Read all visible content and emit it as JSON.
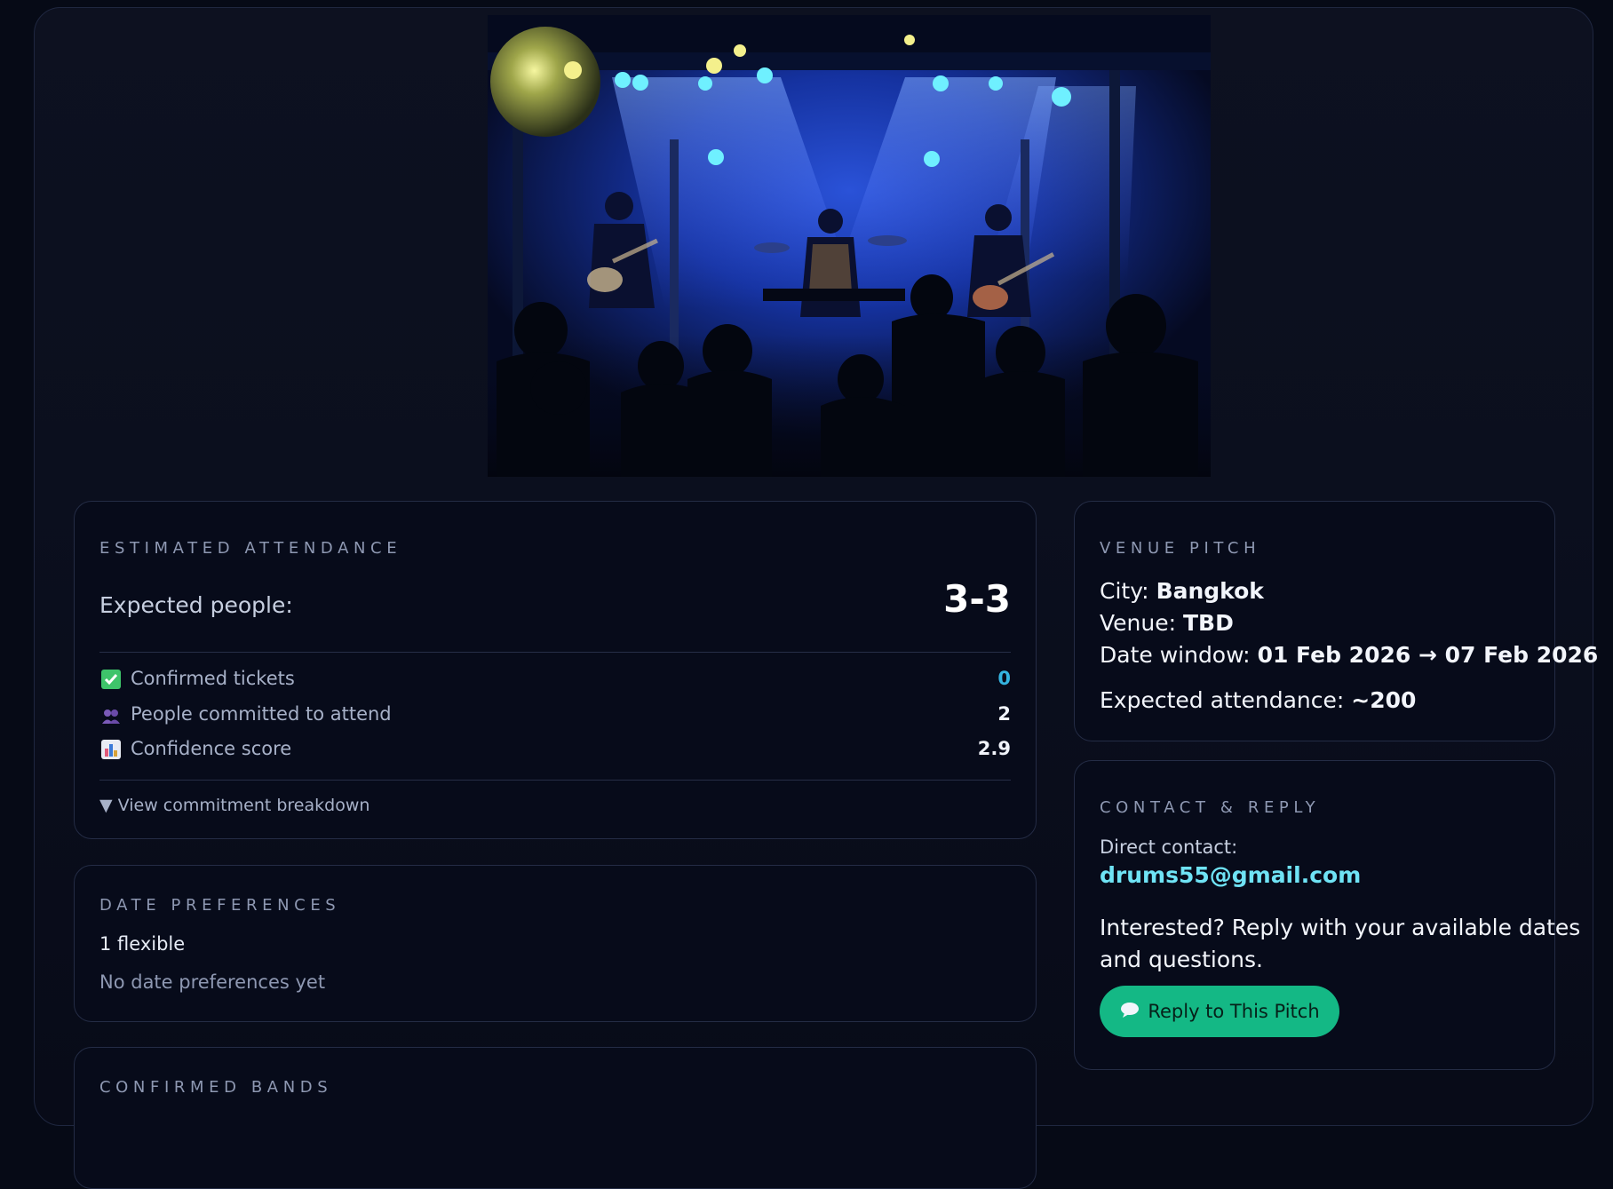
{
  "attendance": {
    "heading": "ESTIMATED ATTENDANCE",
    "expected_label": "Expected people:",
    "expected_value": "3-3",
    "rows": [
      {
        "icon": "check-box-icon",
        "label": "Confirmed tickets",
        "value": "0",
        "color": "#34b4e0"
      },
      {
        "icon": "people-icon",
        "label": "People committed to attend",
        "value": "2",
        "color": "#f0f3fa"
      },
      {
        "icon": "bar-chart-icon",
        "label": "Confidence score",
        "value": "2.9",
        "color": "#f0f3fa"
      }
    ],
    "breakdown_arrow": "▼",
    "breakdown_label": "View commitment breakdown"
  },
  "date_prefs": {
    "heading": "DATE PREFERENCES",
    "summary": "1 flexible",
    "empty_text": "No date preferences yet"
  },
  "bands": {
    "heading": "CONFIRMED BANDS"
  },
  "pitch": {
    "heading": "VENUE PITCH",
    "city_label": "City:",
    "city_value": "Bangkok",
    "venue_label": "Venue:",
    "venue_value": "TBD",
    "window_label": "Date window:",
    "window_value": "01 Feb 2026 → 07 Feb 2026",
    "attendance_label": "Expected attendance:",
    "attendance_value": "~200"
  },
  "contact": {
    "heading": "CONTACT & REPLY",
    "direct_label": "Direct contact:",
    "email": "drums55@gmail.com",
    "prompt_line1": "Interested? Reply with your available dates",
    "prompt_line2": "and questions.",
    "reply_icon": "speech-bubble-icon",
    "reply_label": "Reply to This Pitch"
  },
  "colors": {
    "accent_green": "#14b885",
    "link_cyan": "#6fe3f5",
    "stat_blue": "#34b4e0"
  }
}
